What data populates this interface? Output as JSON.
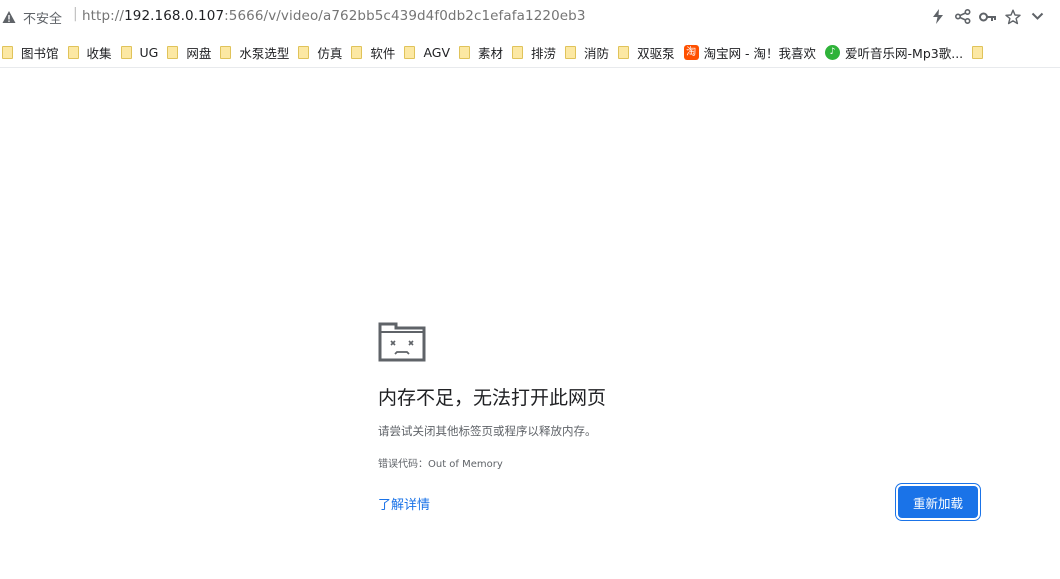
{
  "address_bar": {
    "security_label": "不安全",
    "separator": "|",
    "url_scheme": "http://",
    "url_host": "192.168.0.107",
    "url_rest": ":5666/v/video/a762bb5c439d4f0db2c1efafa1220eb3",
    "icons": [
      "lightning-icon",
      "share-icon",
      "key-icon",
      "star-icon",
      "chevron-down-icon"
    ]
  },
  "bookmarks": [
    {
      "label": "图书馆",
      "icon": "folder-icon"
    },
    {
      "label": "收集",
      "icon": "folder-icon"
    },
    {
      "label": "UG",
      "icon": "folder-icon"
    },
    {
      "label": "网盘",
      "icon": "folder-icon"
    },
    {
      "label": "水泵选型",
      "icon": "folder-icon"
    },
    {
      "label": "仿真",
      "icon": "folder-icon"
    },
    {
      "label": "软件",
      "icon": "folder-icon"
    },
    {
      "label": "AGV",
      "icon": "folder-icon"
    },
    {
      "label": "素材",
      "icon": "folder-icon"
    },
    {
      "label": "排涝",
      "icon": "folder-icon"
    },
    {
      "label": "消防",
      "icon": "folder-icon"
    },
    {
      "label": "双驱泵",
      "icon": "folder-icon"
    },
    {
      "label": "淘宝网 - 淘！我喜欢",
      "icon": "taobao-icon",
      "icon_text": "淘"
    },
    {
      "label": "爱听音乐网-Mp3歌...",
      "icon": "music-icon",
      "icon_text": "♪"
    }
  ],
  "error": {
    "title": "内存不足，无法打开此网页",
    "hint": "请尝试关闭其他标签页或程序以释放内存。",
    "code_label": "错误代码：",
    "code": "Out of Memory",
    "details_link": "了解详情",
    "reload_button": "重新加载"
  },
  "colors": {
    "accent": "#1a73e8",
    "folder": "#fce8a3",
    "text_secondary": "#5f6368"
  }
}
